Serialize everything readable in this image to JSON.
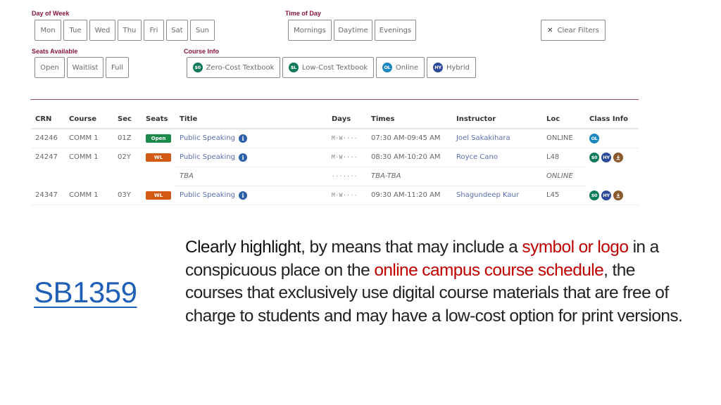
{
  "filters": {
    "day_of_week": {
      "label": "Day of Week",
      "options": [
        "Mon",
        "Tue",
        "Wed",
        "Thu",
        "Fri",
        "Sat",
        "Sun"
      ]
    },
    "time_of_day": {
      "label": "Time of Day",
      "options": [
        "Mornings",
        "Daytime",
        "Evenings"
      ]
    },
    "clear_filters": {
      "icon": "close-icon",
      "label": "Clear Filters"
    },
    "seats_available": {
      "label": "Seats Available",
      "options": [
        "Open",
        "Waitlist",
        "Full"
      ]
    },
    "course_info": {
      "label": "Course Info",
      "options": [
        {
          "badge": "$0",
          "label": "Zero-Cost Textbook",
          "color": "#0f7a5a"
        },
        {
          "badge": "$L",
          "label": "Low-Cost Textbook",
          "color": "#0f7a5a"
        },
        {
          "badge": "OL",
          "label": "Online",
          "color": "#1a87c0"
        },
        {
          "badge": "HY",
          "label": "Hybrid",
          "color": "#2c4a9a"
        }
      ]
    }
  },
  "table": {
    "headers": [
      "CRN",
      "Course",
      "Sec",
      "Seats",
      "Title",
      "Days",
      "Times",
      "Instructor",
      "Loc",
      "Class Info"
    ],
    "rows": [
      {
        "crn": "24246",
        "course": "COMM 1",
        "sec": "01Z",
        "seats": "Open",
        "seats_color": "#1a8a4a",
        "title": "Public Speaking",
        "days": "M·W····",
        "times": "07:30 AM-09:45 AM",
        "instructor": "Joel Sakakihara",
        "loc": "ONLINE",
        "class_info": [
          "OL"
        ]
      },
      {
        "crn": "24247",
        "course": "COMM 1",
        "sec": "02Y",
        "seats": "WL",
        "seats_color": "#d35a14",
        "title": "Public Speaking",
        "days": "M·W····",
        "times": "08:30 AM-10:20 AM",
        "instructor": "Royce Cano",
        "loc": "L48",
        "class_info": [
          "$0",
          "HY",
          "download"
        ]
      },
      {
        "sub": true,
        "title": "TBA",
        "days": "·······",
        "times": "TBA-TBA",
        "loc": "ONLINE"
      },
      {
        "crn": "24347",
        "course": "COMM 1",
        "sec": "03Y",
        "seats": "WL",
        "seats_color": "#d35a14",
        "title": "Public Speaking",
        "days": "M·W····",
        "times": "09:30 AM-11:20 AM",
        "instructor": "Shagundeep Kaur",
        "loc": "L45",
        "class_info": [
          "$0",
          "HY",
          "download"
        ]
      }
    ]
  },
  "badge_colors": {
    "$0": "#0f7a5a",
    "$L": "#0f7a5a",
    "OL": "#1a87c0",
    "HY": "#2c4a9a",
    "download": "#8a5a2e"
  },
  "slide": {
    "bill_link": "SB1359",
    "body": {
      "p1": "Clearly highlight",
      "p2": ", by means that may include a ",
      "p3": "symbol or logo",
      "p4": " in a conspicuous place on the ",
      "p5": "online campus course schedule",
      "p6": ", the courses that exclusively use digital course materials that are free of charge to students and may have a low-cost option for print versions."
    }
  }
}
